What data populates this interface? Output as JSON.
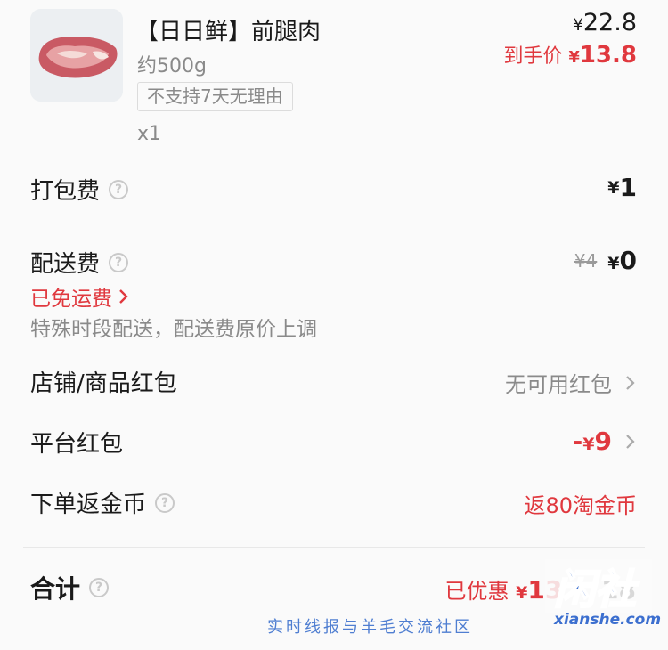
{
  "product": {
    "image_icon": "pork-leg-image",
    "title": "【日日鲜】前腿肉",
    "spec": "约500g",
    "tag": "不支持7天无理由",
    "qty": "x1",
    "price_symbol": "¥",
    "price": "22.8",
    "promo_label": "到手价",
    "promo_symbol": "¥",
    "promo_price": "13.8"
  },
  "packing_fee": {
    "label": "打包费",
    "help_icon": "question-icon",
    "symbol": "¥",
    "value": "1"
  },
  "delivery_fee": {
    "label": "配送费",
    "help_icon": "question-icon",
    "original": "¥4",
    "symbol": "¥",
    "value": "0",
    "free_label": "已免运费",
    "note": "特殊时段配送，配送费原价上调"
  },
  "store_coupon": {
    "label": "店铺/商品红包",
    "value": "无可用红包",
    "chevron_icon": "chevron-right-icon"
  },
  "platform_coupon": {
    "label": "平台红包",
    "prefix": "-",
    "symbol": "¥",
    "value": "9",
    "chevron_icon": "chevron-right-icon"
  },
  "coins": {
    "label": "下单返金币",
    "help_icon": "question-icon",
    "value": "返80淘金币"
  },
  "total": {
    "label": "合计",
    "help_icon": "question-icon",
    "discount_label": "已优惠",
    "symbol": "¥",
    "discount_value": "13",
    "amount_partial": "18"
  },
  "watermark": {
    "logo_text": "闲社",
    "site": "xianshe.com",
    "slogan": "实时线报与羊毛交流社区"
  },
  "colors": {
    "accent_red": "#e0383e",
    "muted_grey": "#8a8a8a",
    "watermark_blue": "#3c6fcf"
  }
}
